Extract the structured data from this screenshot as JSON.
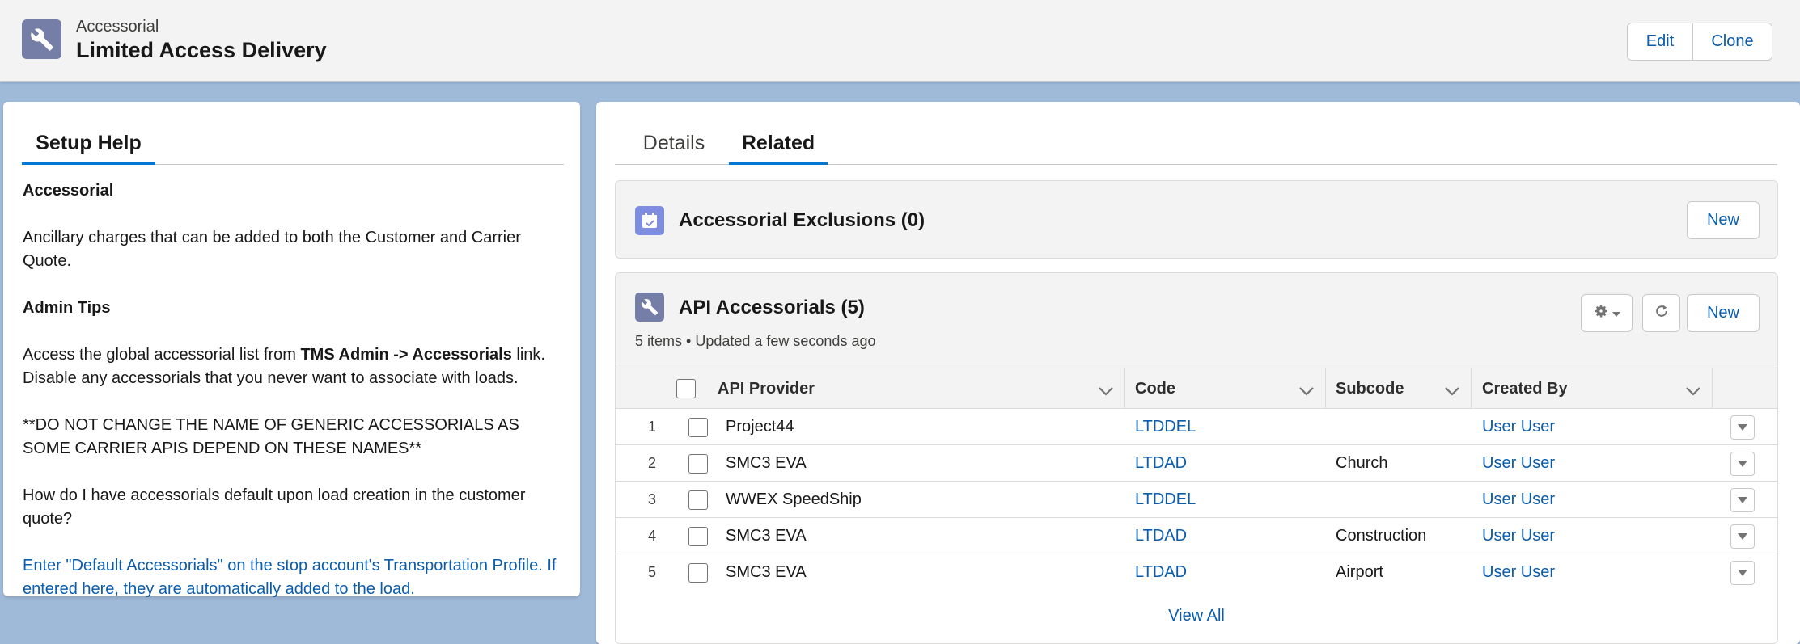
{
  "header": {
    "object_label": "Accessorial",
    "record_title": "Limited Access Delivery",
    "icon": "wrench-icon",
    "edit_label": "Edit",
    "clone_label": "Clone"
  },
  "setup_help": {
    "tab_label": "Setup Help",
    "heading1": "Accessorial",
    "description": "Ancillary charges that can be added to both the Customer and Carrier Quote.",
    "heading2": "Admin Tips",
    "tip_prefix": "Access the global accessorial list from ",
    "tip_bold": "TMS Admin -> Accessorials",
    "tip_suffix": " link.",
    "tip_line2": "Disable any accessorials that you never want to associate with loads.",
    "warning": "**DO NOT CHANGE THE NAME OF GENERIC ACCESSORIALS AS SOME CARRIER APIS DEPEND ON THESE NAMES**",
    "question": "How do I have accessorials default upon load creation in the customer quote?",
    "answer": "Enter \"Default Accessorials\" on the stop account's Transportation Profile. If entered here, they are automatically added to the load."
  },
  "tabs": {
    "details": "Details",
    "related": "Related"
  },
  "exclusions_card": {
    "title": "Accessorial Exclusions (0)",
    "icon": "calendar-icon",
    "new_label": "New"
  },
  "api_card": {
    "title": "API Accessorials (5)",
    "icon": "wrench-icon",
    "subtitle": "5 items • Updated a few seconds ago",
    "new_label": "New",
    "columns": [
      "API Provider",
      "Code",
      "Subcode",
      "Created By"
    ],
    "rows": [
      {
        "num": "1",
        "provider": "Project44",
        "code": "LTDDEL",
        "subcode": "",
        "created_by": "User User"
      },
      {
        "num": "2",
        "provider": "SMC3 EVA",
        "code": "LTDAD",
        "subcode": "Church",
        "created_by": "User User"
      },
      {
        "num": "3",
        "provider": "WWEX SpeedShip",
        "code": "LTDDEL",
        "subcode": "",
        "created_by": "User User"
      },
      {
        "num": "4",
        "provider": "SMC3 EVA",
        "code": "LTDAD",
        "subcode": "Construction",
        "created_by": "User User"
      },
      {
        "num": "5",
        "provider": "SMC3 EVA",
        "code": "LTDAD",
        "subcode": "Airport",
        "created_by": "User User"
      }
    ],
    "view_all": "View All"
  },
  "colors": {
    "background": "#9fb9d8",
    "accent": "#0176d3",
    "link": "#0b5cab",
    "header_icon": "#747ea7",
    "exclusion_icon": "#7f8de1"
  }
}
